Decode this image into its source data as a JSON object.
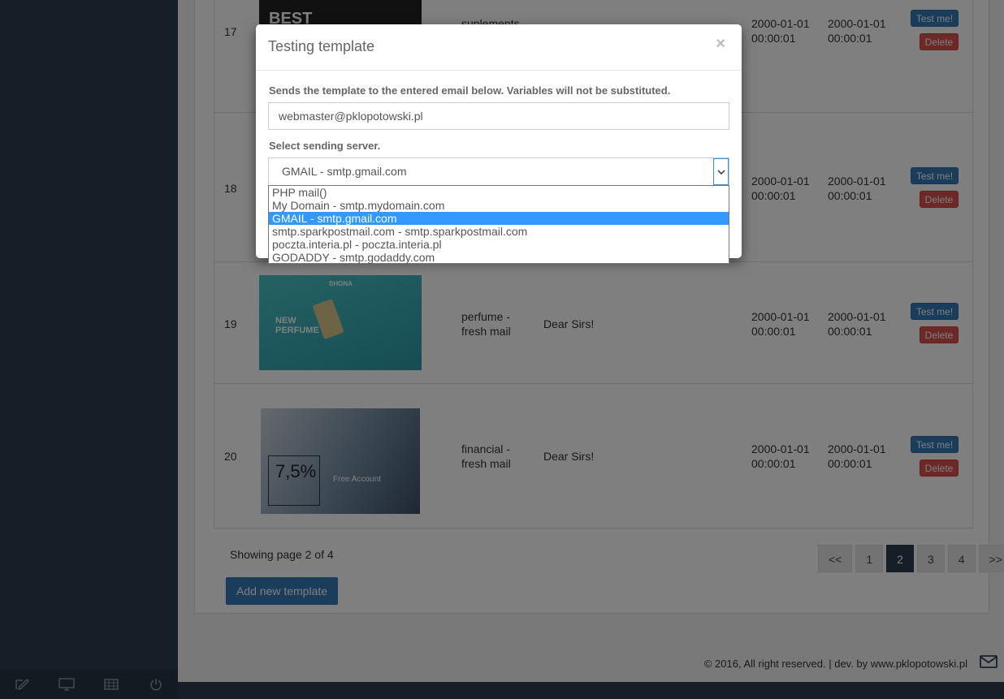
{
  "rows": [
    {
      "id": "17",
      "name_line1": "suplements -",
      "name_line2": "",
      "subject": "",
      "created_date": "2000-01-01",
      "created_time": "00:00:01",
      "modified_date": "2000-01-01",
      "modified_time": "00:00:01",
      "thumb_text": "BEST"
    },
    {
      "id": "18",
      "name_line1": "",
      "name_line2": "",
      "subject": "",
      "created_date": "2000-01-01",
      "created_time": "00:00:01",
      "modified_date": "2000-01-01",
      "modified_time": "00:00:01",
      "thumb_text": ""
    },
    {
      "id": "19",
      "name_line1": "perfume -",
      "name_line2": "fresh mail",
      "subject": "Dear Sirs!",
      "created_date": "2000-01-01",
      "created_time": "00:00:01",
      "modified_date": "2000-01-01",
      "modified_time": "00:00:01",
      "thumb_text": "NEW PERFUME"
    },
    {
      "id": "20",
      "name_line1": "financial -",
      "name_line2": "fresh mail",
      "subject": "Dear Sirs!",
      "created_date": "2000-01-01",
      "created_time": "00:00:01",
      "modified_date": "2000-01-01",
      "modified_time": "00:00:01",
      "thumb_text": "7,5%"
    }
  ],
  "actions": {
    "test_label": "Test me!",
    "delete_label": "Delete"
  },
  "pagination": {
    "showing": "Showing page 2 of 4",
    "prev": "<<",
    "pages": [
      "1",
      "2",
      "3",
      "4"
    ],
    "current": "2",
    "next": ">>"
  },
  "add_button": "Add new template",
  "footer": {
    "text": "© 2016, All right reserved. | dev. by www.pklopotowski.pl"
  },
  "thumbs": {
    "perfume_brand": "SHONA",
    "financial_sub": "Free Account"
  },
  "modal": {
    "title": "Testing template",
    "close": "×",
    "instruction": "Sends the template to the entered email below. Variables will not be substituted.",
    "email_value": "webmaster@pklopotowski.pl",
    "server_label": "Select sending server.",
    "selected_server": "GMAIL - smtp.gmail.com",
    "server_options": [
      "PHP mail()",
      "My Domain - smtp.mydomain.com",
      "GMAIL - smtp.gmail.com",
      "smtp.sparkpostmail.com  - smtp.sparkpostmail.com",
      "poczta.interia.pl - poczta.interia.pl",
      "GODADDY - smtp.godaddy.com"
    ]
  },
  "colors": {
    "sidebar": "#2c3e50",
    "primary": "#337ab7",
    "danger": "#d9534f",
    "highlight": "#3399ff"
  }
}
